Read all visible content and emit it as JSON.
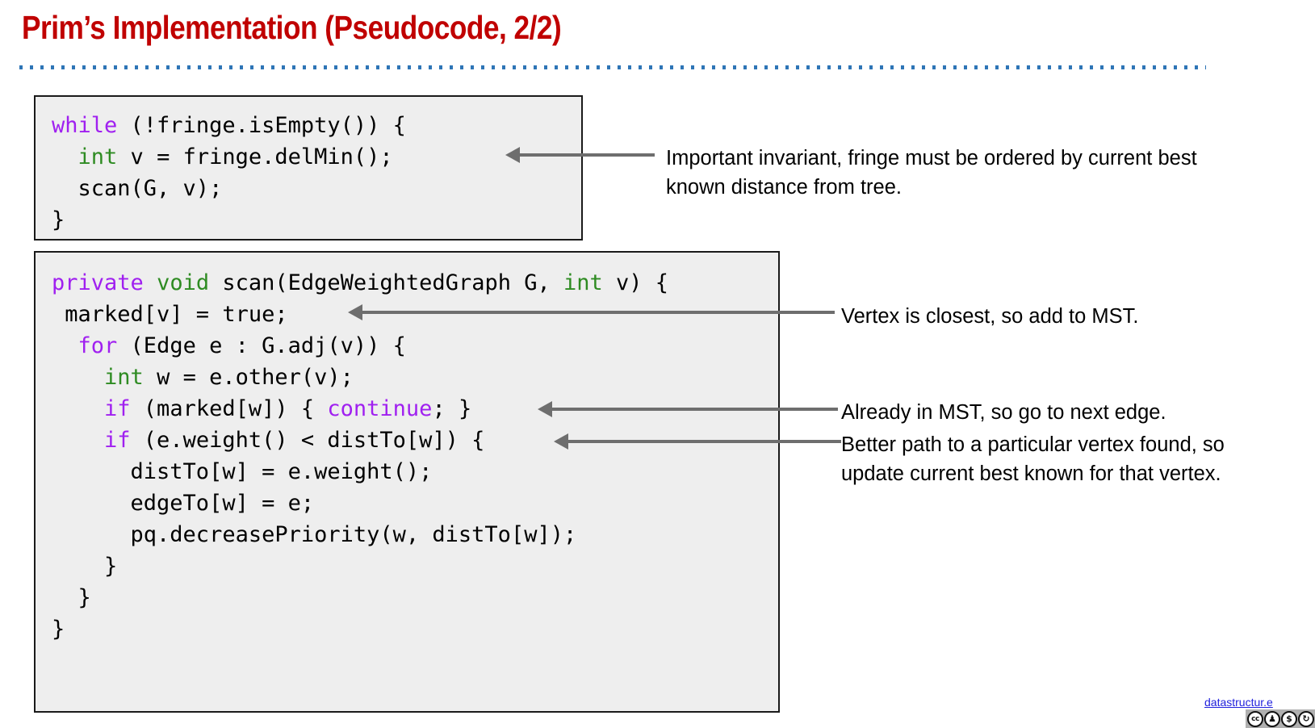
{
  "slide": {
    "title": "Prim’s Implementation (Pseudocode, 2/2)",
    "title_color": "#C00000",
    "divider_color": "#2E75B6",
    "background": "#FFFFFF"
  },
  "code_blocks": [
    {
      "name": "prim-main-loop",
      "background": "#EEEEEE",
      "border_color": "#1A1A1A",
      "lines": [
        [
          {
            "t": "while",
            "c": "keyword"
          },
          {
            "t": " (!fringe.isEmpty()) {",
            "c": "plain"
          }
        ],
        [
          {
            "t": "  ",
            "c": "plain"
          },
          {
            "t": "int",
            "c": "type"
          },
          {
            "t": " v = fringe.delMin();",
            "c": "plain"
          }
        ],
        [
          {
            "t": "  scan(G, v);",
            "c": "plain"
          }
        ],
        [
          {
            "t": "}",
            "c": "plain"
          }
        ]
      ]
    },
    {
      "name": "prim-scan-method",
      "background": "#EEEEEE",
      "border_color": "#1A1A1A",
      "lines": [
        [
          {
            "t": "private",
            "c": "keyword"
          },
          {
            "t": " ",
            "c": "plain"
          },
          {
            "t": "void",
            "c": "type"
          },
          {
            "t": " scan(EdgeWeightedGraph G, ",
            "c": "plain"
          },
          {
            "t": "int",
            "c": "type"
          },
          {
            "t": " v) {",
            "c": "plain"
          }
        ],
        [
          {
            "t": " marked[v] = true;",
            "c": "plain"
          }
        ],
        [
          {
            "t": "  ",
            "c": "plain"
          },
          {
            "t": "for",
            "c": "keyword"
          },
          {
            "t": " (Edge e : G.adj(v)) {",
            "c": "plain"
          }
        ],
        [
          {
            "t": "    ",
            "c": "plain"
          },
          {
            "t": "int",
            "c": "type"
          },
          {
            "t": " w = e.other(v);",
            "c": "plain"
          }
        ],
        [
          {
            "t": "    ",
            "c": "plain"
          },
          {
            "t": "if",
            "c": "keyword"
          },
          {
            "t": " (marked[w]) { ",
            "c": "plain"
          },
          {
            "t": "continue",
            "c": "keyword"
          },
          {
            "t": "; }",
            "c": "plain"
          }
        ],
        [
          {
            "t": "    ",
            "c": "plain"
          },
          {
            "t": "if",
            "c": "keyword"
          },
          {
            "t": " (e.weight() < distTo[w]) {",
            "c": "plain"
          }
        ],
        [
          {
            "t": "      distTo[w] = e.weight();",
            "c": "plain"
          }
        ],
        [
          {
            "t": "      edgeTo[w] = e;",
            "c": "plain"
          }
        ],
        [
          {
            "t": "      pq.decreasePriority(w, distTo[w]);",
            "c": "plain"
          }
        ],
        [
          {
            "t": "    }",
            "c": "plain"
          }
        ],
        [
          {
            "t": "  }",
            "c": "plain"
          }
        ],
        [
          {
            "t": "}",
            "c": "plain"
          }
        ]
      ]
    }
  ],
  "syntax_colors": {
    "keyword": "#A020F0",
    "type": "#2E8B22",
    "plain": "#000000"
  },
  "annotations": [
    {
      "id": "annotation-1",
      "text": "Important invariant, fringe must be ordered by current best known distance from tree."
    },
    {
      "id": "annotation-2",
      "text": "Vertex is closest, so add to MST."
    },
    {
      "id": "annotation-3",
      "text": "Already in MST, so go to next edge."
    },
    {
      "id": "annotation-4",
      "text": "Better path to a particular vertex found, so update current best known for that vertex."
    }
  ],
  "arrows": {
    "color": "#6E6E6E",
    "count": 4,
    "direction": "points-left"
  },
  "footer": {
    "link_text": "datastructur.e",
    "link_color": "#2222DD",
    "license_badge": {
      "name": "creative-commons-by-nc-sa",
      "icons": [
        "cc",
        "by",
        "nc",
        "sa"
      ],
      "glyphs": [
        "cc",
        "f",
        "$",
        "↺"
      ]
    }
  }
}
